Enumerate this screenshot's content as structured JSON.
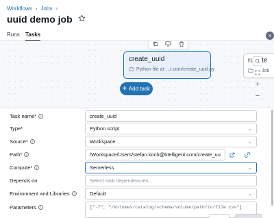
{
  "breadcrumb": {
    "item1": "Workflows",
    "sep": "›",
    "item2": "Jobs",
    "item3": "›"
  },
  "page_title": "uuid demo job",
  "tabs": {
    "runs": "Runs",
    "tasks": "Tasks"
  },
  "canvas": {
    "selected_task": {
      "title": "create_uuid",
      "type_label": "Python file at",
      "path_short": "...t.com/create_uuid.py"
    },
    "other_task": {
      "title": "run_te",
      "sub": "Job"
    },
    "add_task_label": "Add task",
    "add_task_plus": "+",
    "zoom_in": "+",
    "zoom_out": "−",
    "close": "×"
  },
  "form": {
    "task_name": {
      "label": "Task name*",
      "value": "create_uuid"
    },
    "type": {
      "label": "Type*",
      "value": "Python script"
    },
    "source": {
      "label": "Source*",
      "value": "Workspace"
    },
    "path": {
      "label": "Path*",
      "value": "/Workspace/Users/stefan.koch@btelligent.com/create_uuid.py"
    },
    "compute": {
      "label": "Compute*",
      "value": "Serverless"
    },
    "depends_on": {
      "label": "Depends on",
      "placeholder": "Select task dependencies..."
    },
    "env_libs": {
      "label": "Environment and Libraries",
      "value": "Default"
    },
    "parameters": {
      "label": "Parameters",
      "value": "[\"-f\", \"/Volumes/catalog/schema/volume/path/to/file.csv\"]"
    }
  },
  "colors": {
    "accent": "#2272b4",
    "selected_node_bg": "#e8f1fb"
  },
  "icons": [
    "star-icon",
    "copy-icon",
    "run-icon",
    "trash-icon",
    "file-icon",
    "job-icon",
    "search-icon",
    "fullscreen-icon",
    "chevron-down-icon",
    "external-link-icon",
    "copy-path-icon",
    "info-icon"
  ]
}
